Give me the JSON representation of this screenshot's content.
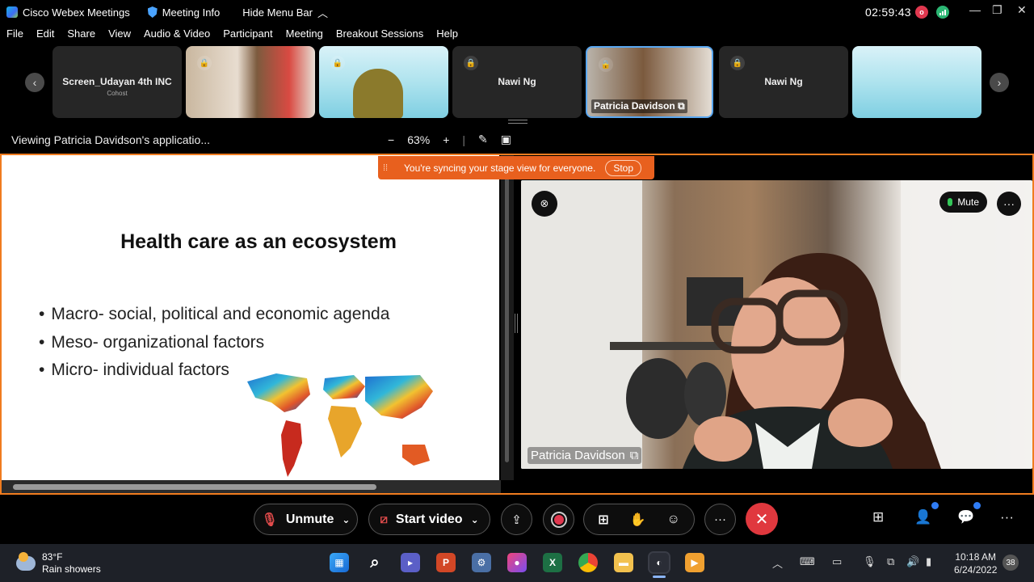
{
  "titlebar": {
    "app_name": "Cisco Webex Meetings",
    "meeting_info": "Meeting Info",
    "hide_menu": "Hide Menu Bar",
    "timer": "02:59:43"
  },
  "menu": [
    "File",
    "Edit",
    "Share",
    "View",
    "Audio & Video",
    "Participant",
    "Meeting",
    "Breakout Sessions",
    "Help"
  ],
  "thumbnails": [
    {
      "name": "Screen_Udayan 4th INC",
      "sub": "Cohost"
    },
    {
      "name": "",
      "sub": ""
    },
    {
      "name": "",
      "sub": ""
    },
    {
      "name": "Nawi Ng",
      "sub": ""
    },
    {
      "name": "Patricia Davidson",
      "sub": ""
    },
    {
      "name": "Nawi Ng",
      "sub": ""
    },
    {
      "name": "",
      "sub": ""
    }
  ],
  "viewbar": {
    "viewing": "Viewing Patricia Davidson's applicatio...",
    "zoom": "63%",
    "minus": "−",
    "plus": "+"
  },
  "sync_banner": {
    "message": "You're syncing your stage view for everyone.",
    "stop": "Stop"
  },
  "slide": {
    "title": "Health care as an ecosystem",
    "bullets": [
      "Macro- social, political and economic agenda",
      "Meso- organizational factors",
      "Micro- individual factors"
    ]
  },
  "video": {
    "participant": "Patricia Davidson",
    "mute": "Mute"
  },
  "controls": {
    "unmute": "Unmute",
    "start_video": "Start video"
  },
  "taskbar": {
    "temperature": "83°F",
    "weather": "Rain showers",
    "time": "10:18 AM",
    "date": "6/24/2022",
    "notifications": "38"
  }
}
